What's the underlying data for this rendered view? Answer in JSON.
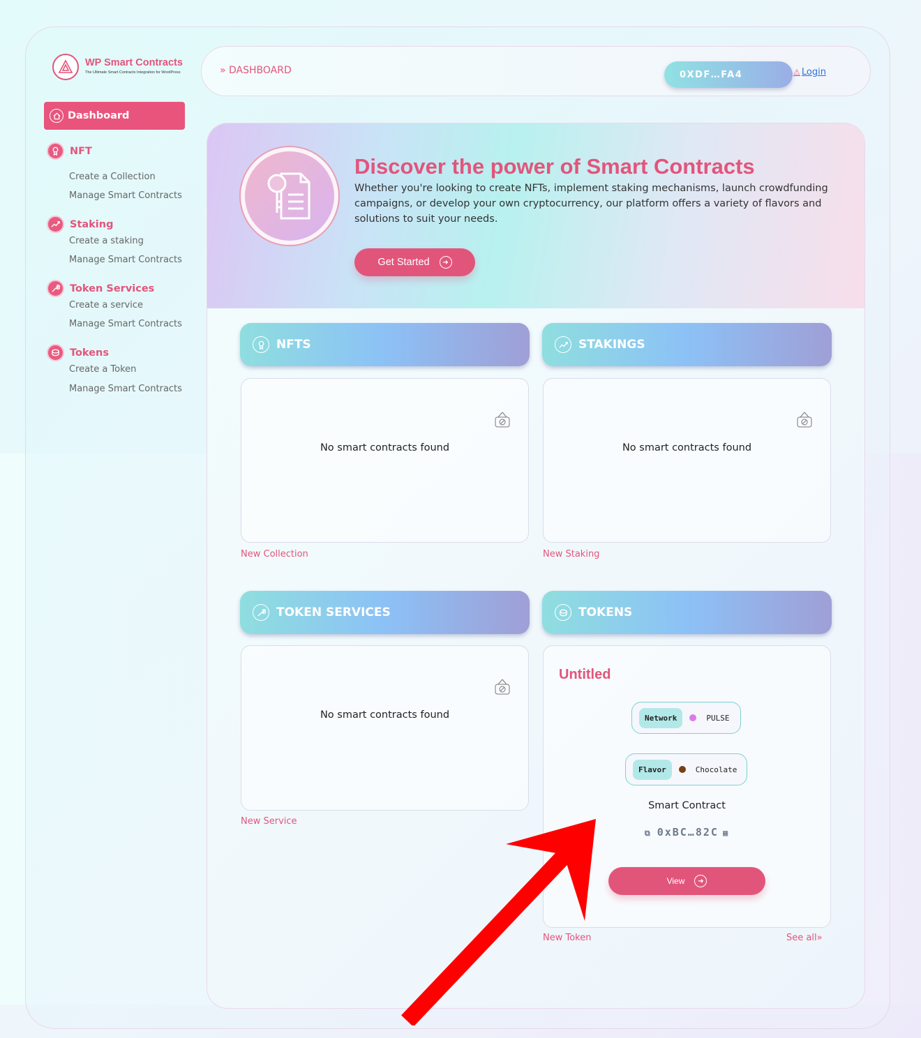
{
  "brand": {
    "name": "WP Smart Contracts",
    "tagline": "The Ultimate Smart Contracts Integration for WordPress"
  },
  "sidebar": {
    "active": "Dashboard",
    "groups": [
      {
        "title": "NFT",
        "items": [
          "Create a Collection",
          "Manage Smart Contracts"
        ]
      },
      {
        "title": "Staking",
        "items": [
          "Create a staking",
          "Manage Smart Contracts"
        ]
      },
      {
        "title": "Token Services",
        "items": [
          "Create a service",
          "Manage Smart Contracts"
        ]
      },
      {
        "title": "Tokens",
        "items": [
          "Create a Token",
          "Manage Smart Contracts"
        ]
      }
    ]
  },
  "header": {
    "breadcrumb": "» DASHBOARD",
    "wallet": "0XDF…FA4",
    "login_warning": "⚠",
    "login": "Login"
  },
  "hero": {
    "title": "Discover the power of Smart Contracts",
    "text": "Whether you're looking to create NFTs, implement staking mechanisms, launch crowdfunding campaigns, or develop your own cryptocurrency, our platform offers a variety of flavors and solutions to suit your needs.",
    "button": "Get Started"
  },
  "sections": {
    "nfts": {
      "title": "NFTS",
      "empty": "No smart contracts found",
      "link": "New Collection"
    },
    "stakings": {
      "title": "STAKINGS",
      "empty": "No smart contracts found",
      "link": "New Staking"
    },
    "token_services": {
      "title": "TOKEN SERVICES",
      "empty": "No smart contracts found",
      "link": "New Service"
    },
    "tokens": {
      "title": "TOKENS",
      "card": {
        "name": "Untitled",
        "network_label": "Network",
        "network_value": "PULSE",
        "network_color": "#d97ce8",
        "flavor_label": "Flavor",
        "flavor_value": "Chocolate",
        "flavor_color": "#7a3e12",
        "contract_label": "Smart Contract",
        "address": "0xBC…82C",
        "view": "View"
      },
      "link": "New Token",
      "see_all": "See all»"
    }
  },
  "colors": {
    "accent": "#e2557b",
    "annotation": "#ff0000"
  }
}
